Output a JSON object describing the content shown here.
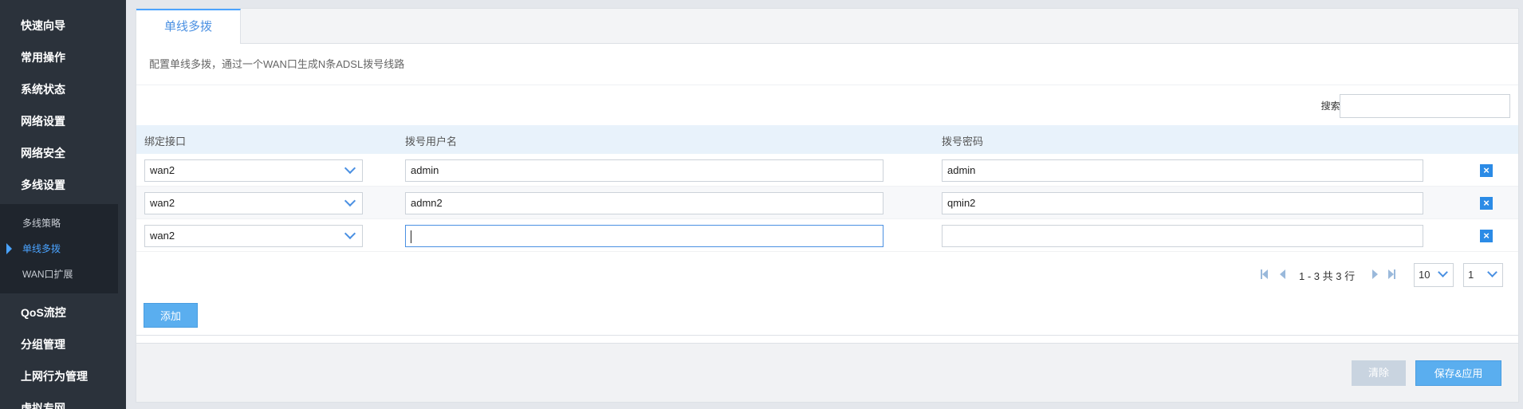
{
  "sidebar": {
    "items_top": [
      {
        "label": "快速向导"
      },
      {
        "label": "常用操作"
      },
      {
        "label": "系统状态"
      },
      {
        "label": "网络设置"
      },
      {
        "label": "网络安全"
      },
      {
        "label": "多线设置"
      }
    ],
    "submenu": [
      {
        "label": "多线策略"
      },
      {
        "label": "单线多拨"
      },
      {
        "label": "WAN口扩展"
      }
    ],
    "items_bottom": [
      {
        "label": "QoS流控"
      },
      {
        "label": "分组管理"
      },
      {
        "label": "上网行为管理"
      },
      {
        "label": "虚拟专网"
      }
    ]
  },
  "tab": {
    "label": "单线多拨"
  },
  "description": "配置单线多拨，通过一个WAN口生成N条ADSL拨号线路",
  "search": {
    "label": "搜索:",
    "value": ""
  },
  "table": {
    "headers": {
      "interface": "绑定接口",
      "username": "拨号用户名",
      "password": "拨号密码"
    },
    "rows": [
      {
        "interface": "wan2",
        "username": "admin",
        "password": "admin"
      },
      {
        "interface": "wan2",
        "username": "admn2",
        "password": "qmin2"
      },
      {
        "interface": "wan2",
        "username": "",
        "password": ""
      }
    ],
    "delete_glyph": "×"
  },
  "pager": {
    "info": "1 - 3 共 3 行",
    "page_size": "10",
    "page": "1"
  },
  "buttons": {
    "add": "添加",
    "clear": "清除",
    "save": "保存&应用"
  },
  "colors": {
    "accent": "#4aa3ff",
    "sidebar_bg": "#2b323b",
    "button_bg": "#5aaeef"
  }
}
